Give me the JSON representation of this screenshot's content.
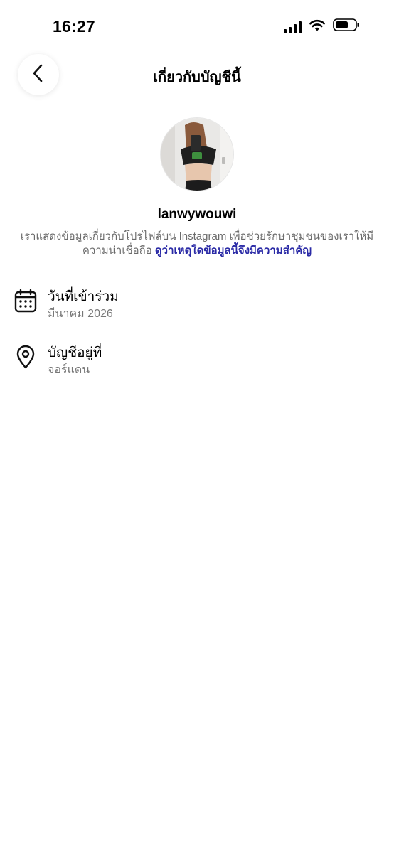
{
  "status_bar": {
    "time": "16:27",
    "icons": [
      "signal-icon",
      "wifi-icon",
      "battery-icon"
    ]
  },
  "nav": {
    "back_icon": "chevron-left-icon",
    "title": "เกี่ยวกับบัญชีนี้"
  },
  "profile": {
    "username": "lanwywouwi",
    "info_text": "เราแสดงข้อมูลเกี่ยวกับโปรไฟล์บน Instagram เพื่อช่วยรักษาชุมชนของเราให้มีความน่าเชื่อถือ",
    "info_link": "ดูว่าเหตุใดข้อมูลนี้จึงมีความสำคัญ"
  },
  "details": [
    {
      "icon": "calendar-icon",
      "title": "วันที่เข้าร่วม",
      "value": "มีนาคม 2026"
    },
    {
      "icon": "location-pin-icon",
      "title": "บัญชีอยู่ที่",
      "value": "จอร์แดน"
    }
  ],
  "colors": {
    "link": "#2a2aa6",
    "secondary_text": "#6b6b6b"
  }
}
